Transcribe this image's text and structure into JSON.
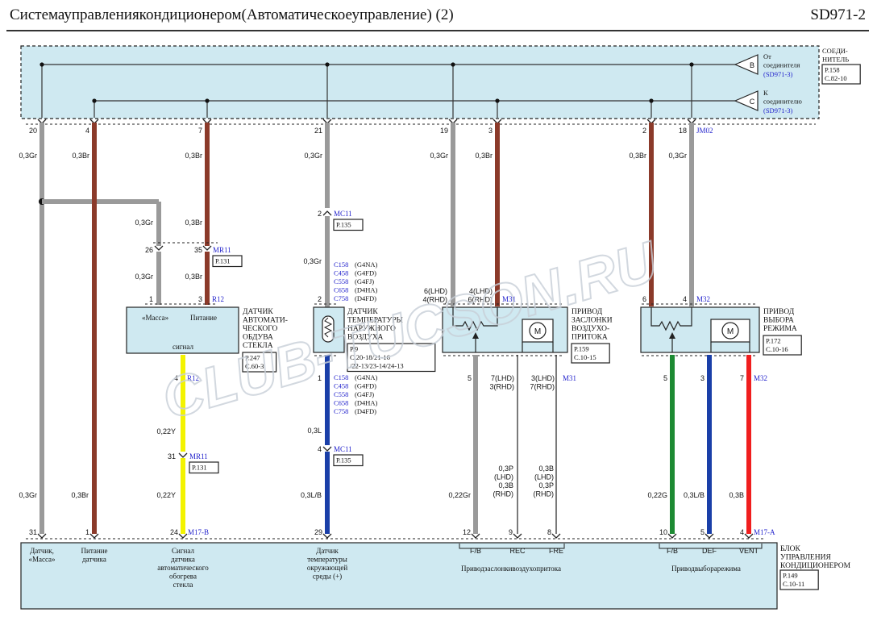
{
  "header": {
    "title": "Системауправлениякондиционером(Автоматическоеуправление) (2)",
    "code": "SD971-2"
  },
  "top_block": {
    "label_lines": [
      "СОЕДИ-",
      "НИТЕЛЬ"
    ],
    "ref_lines": [
      "P.158",
      "C.82-10"
    ],
    "connector_b": {
      "letter": "B",
      "text_lines": [
        "От",
        "соединителя"
      ],
      "ref": "(SD971-3)"
    },
    "connector_c": {
      "letter": "C",
      "text_lines": [
        "К",
        "соединителю"
      ],
      "ref": "(SD971-3)"
    }
  },
  "wires": [
    {
      "pin": "20",
      "gauge": "0,3Gr",
      "color": "#9a9a9a"
    },
    {
      "pin": "4",
      "gauge": "0,3Br",
      "color": "#8b3a2a"
    },
    {
      "pin": "7",
      "gauge": "0,3Br",
      "color": "#8b3a2a"
    },
    {
      "pin": "21",
      "gauge": "0,3Gr",
      "color": "#9a9a9a"
    },
    {
      "pin": "19",
      "gauge": "0,3Gr",
      "color": "#9a9a9a"
    },
    {
      "pin": "3",
      "gauge": "0,3Br",
      "color": "#8b3a2a"
    },
    {
      "pin": "2",
      "gauge": "0,3Br",
      "color": "#8b3a2a"
    },
    {
      "pin": "18",
      "gauge": "0,3Gr",
      "color": "#9a9a9a"
    }
  ],
  "top_connector_code": "JM02",
  "mr11_upper": {
    "pin_left": "26",
    "pin_right": "35",
    "code": "MR11",
    "ref": "P.131",
    "gauge_left_top": "0,3Gr",
    "gauge_right_top": "0,3Br",
    "gauge_left_bottom": "0,3Gr",
    "gauge_right_bottom": "0,3Br"
  },
  "sensor_defrost": {
    "pin_left": "1",
    "pin_right": "3",
    "code": "R12",
    "pin_left_label": "«Масса»",
    "pin_right_label": "Питание",
    "signal_label": "сигнал",
    "title_lines": [
      "ДАТЧИК",
      "АВТОМАТИ-",
      "ЧЕСКОГО",
      "ОБДУВА",
      "СТЕКЛА"
    ],
    "ref_lines": [
      "P.247",
      "C.60-3"
    ],
    "out_pin": "4",
    "out_code": "R12"
  },
  "yellow_wire": {
    "gauge_top": "0,22Y",
    "pin": "31",
    "code": "MR11",
    "ref": "P.131",
    "gauge_bottom": "0,22Y"
  },
  "mc11_upper": {
    "pin": "2",
    "code": "MC11",
    "ref": "P.135",
    "gauge": "0,3Gr"
  },
  "c_list": [
    {
      "code": "C158",
      "engine": "(G4NA)"
    },
    {
      "code": "C458",
      "engine": "(G4FD)"
    },
    {
      "code": "C558",
      "engine": "(G4FJ)"
    },
    {
      "code": "C658",
      "engine": "(D4HA)"
    },
    {
      "code": "C758",
      "engine": "(D4FD)"
    }
  ],
  "ambient_sensor": {
    "pin_top": "2",
    "pin_bottom": "1",
    "title_lines": [
      "ДАТЧИК",
      "ТЕМПЕРАТУРЫ",
      "НАРУЖНОГО",
      "ВОЗДУХА"
    ],
    "ref_lines": [
      "P.9",
      "C.20-18/21-16",
      "/22-13/23-14/24-13"
    ]
  },
  "blue_wire": {
    "gauge": "0,3L",
    "pin": "4",
    "code": "MC11",
    "ref": "P.135",
    "gauge_bottom": "0,3L/B"
  },
  "intake_actuator": {
    "pin_left_lines": [
      "6(LHD)",
      "4(RHD)"
    ],
    "pin_right_lines": [
      "4(LHD)",
      "6(RHD)"
    ],
    "code": "M31",
    "title_lines": [
      "ПРИВОД",
      "ЗАСЛОНКИ",
      "ВОЗДУХО-",
      "ПРИТОКА"
    ],
    "ref_lines": [
      "P.159",
      "C.10-15"
    ],
    "out_pin_left": "5",
    "out_pin_mid_lines": [
      "7(LHD)",
      "3(RHD)"
    ],
    "out_pin_right_lines": [
      "3(LHD)",
      "7(RHD)"
    ],
    "out_code": "M31",
    "motor_letter": "M"
  },
  "mode_actuator": {
    "pin_left": "6",
    "pin_right": "4",
    "code": "M32",
    "title_lines": [
      "ПРИВОД",
      "ВЫБОРА",
      "РЕЖИМА"
    ],
    "ref_lines": [
      "P.172",
      "C.10-16"
    ],
    "out_pins": [
      "5",
      "3",
      "7"
    ],
    "out_code": "M32",
    "motor_letter": "M"
  },
  "bottom_gauges": {
    "w1": "0,3Gr",
    "w2": "0,3Br",
    "w5": "0,22Gr",
    "w6_lines": [
      "0,3P",
      "(LHD)",
      "0,3B",
      "(RHD)"
    ],
    "w7_lines": [
      "0,3B",
      "(LHD)",
      "0,3P",
      "(RHD)"
    ],
    "w8": "0,22G",
    "w9": "0,3L/B",
    "w10": "0,3B"
  },
  "ecu": {
    "pins": [
      "31",
      "1",
      "24",
      "29",
      "12",
      "9",
      "8",
      "10",
      "5",
      "4"
    ],
    "code_b": "M17-B",
    "code_a": "M17-A",
    "labels": [
      {
        "lines": [
          "Датчик,",
          "«Масса»"
        ]
      },
      {
        "lines": [
          "Питание",
          "датчика"
        ]
      },
      {
        "lines": [
          "Сигнал",
          "датчика",
          "автоматического",
          "обогрева",
          "стекла"
        ]
      },
      {
        "lines": [
          "Датчик",
          "температуры",
          "окружающей",
          "среды (+)"
        ]
      }
    ],
    "intake_pins": [
      "F/B",
      "REC",
      "FRE"
    ],
    "intake_label": "Приводзаслонкивоздухопритока",
    "mode_pins": [
      "F/B",
      "DEF",
      "VENT"
    ],
    "mode_label": "Приводвыборарежима",
    "title_lines": [
      "БЛОК",
      "УПРАВЛЕНИЯ",
      "КОНДИЦИОНЕРОМ"
    ],
    "ref_lines": [
      "P.149",
      "C.10-11"
    ]
  },
  "watermark": "CLUB-TUCSON.RU",
  "colors": {
    "gray": "#9a9a9a",
    "brown": "#8b3a2a",
    "yellow": "#f3f300",
    "blue": "#1a3fa8",
    "green": "#1d8a33",
    "red": "#f01e1e",
    "box_fill": "#cfe9f1",
    "code_blue": "#2222cc"
  }
}
